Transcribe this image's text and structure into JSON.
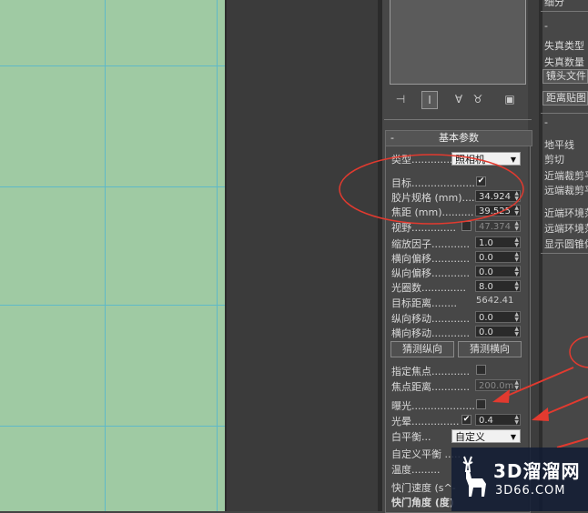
{
  "panel": {
    "section_title": "基本参数",
    "collapse_symbol": "-",
    "toolbar_icons": [
      "pin-icon",
      "modifier-stack-icon",
      "unique-icon",
      "remove-modifier-icon",
      "configure-icon"
    ],
    "params": {
      "type_label": "类型",
      "type_value": "照相机",
      "target_label": "目标",
      "target_checked": true,
      "film_gate_label": "胶片规格 (mm)",
      "film_gate_value": "34.924",
      "focal_length_label": "焦距 (mm)",
      "focal_length_value": "39.525",
      "fov_label": "视野",
      "fov_value": "47.374",
      "fov_checked": false,
      "zoom_label": "缩放因子",
      "zoom_value": "1.0",
      "h_offset_label": "横向偏移",
      "h_offset_value": "0.0",
      "v_offset_label": "纵向偏移",
      "v_offset_value": "0.0",
      "fnumber_label": "光圈数",
      "fnumber_value": "8.0",
      "target_dist_label": "目标距离",
      "target_dist_value": "5642.41",
      "v_shift_label": "纵向移动",
      "v_shift_value": "0.0",
      "h_shift_label": "横向移动",
      "h_shift_value": "0.0",
      "guess_vertical_btn": "猜测纵向",
      "guess_horizontal_btn": "猜测横向",
      "specify_focus_label": "指定焦点",
      "specify_focus_checked": false,
      "focus_dist_label": "焦点距离",
      "focus_dist_value": "200.0m",
      "exposure_label": "曝光",
      "exposure_checked": false,
      "vignetting_label": "光晕",
      "vignetting_checked": true,
      "vignetting_value": "0.4",
      "white_balance_label": "白平衡",
      "white_balance_value": "自定义",
      "custom_wb_label": "自定义平衡",
      "temperature_label": "温度",
      "shutter_speed_label": "快门速度 (s^-",
      "shutter_angle_label": "快门角度 (度)"
    }
  },
  "right_panel": {
    "top_cut": "细分",
    "distortion_type": "失真类型",
    "distortion_amount": "失真数量",
    "lens_file": "镜头文件",
    "distance_map": "距离贴图",
    "horizon": "地平线",
    "clipping": "剪切",
    "near_clip": "近端裁剪平",
    "far_clip": "远端裁剪平",
    "near_env": "近端环境范",
    "far_env": "远端环境范",
    "show_cone": "显示圆锥体"
  },
  "watermark": {
    "brand": "3D溜溜网",
    "url": "3D66.COM"
  },
  "colors": {
    "viewport_bg": "#9fcaa3",
    "grid_line": "#5fb9c8",
    "annotation_red": "#e23a2f"
  }
}
